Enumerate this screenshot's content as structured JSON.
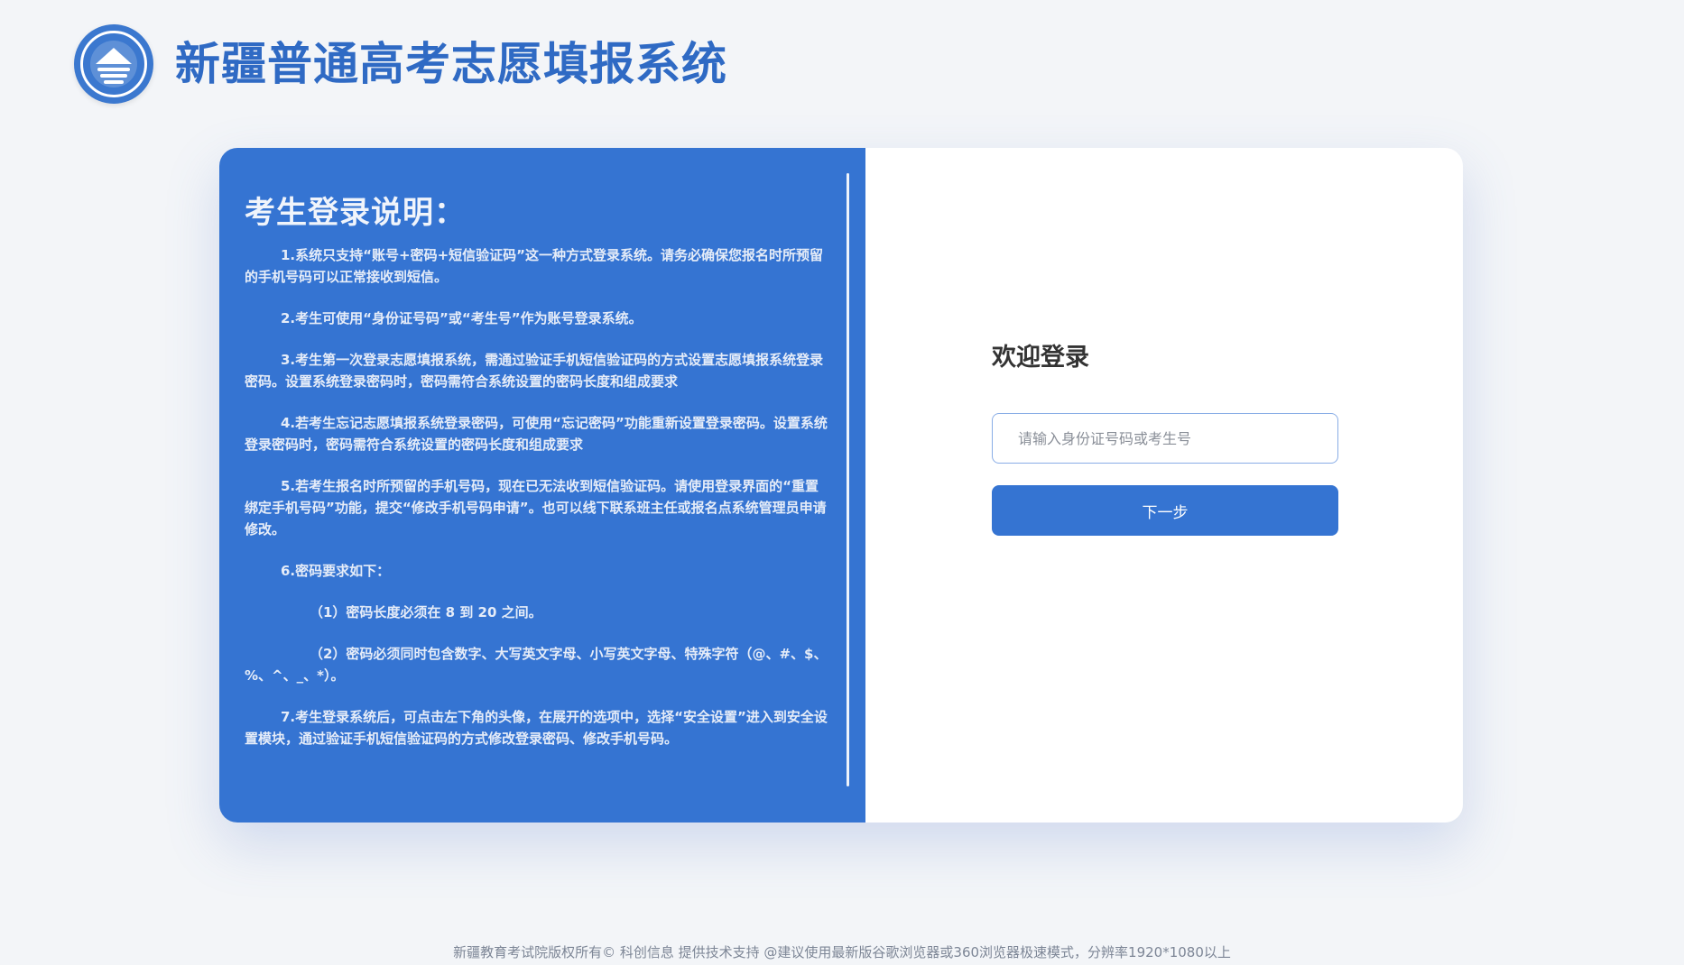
{
  "header": {
    "title": "新疆普通高考志愿填报系统",
    "logo_icon": "education-seal-icon"
  },
  "notice": {
    "title": "考生登录说明：",
    "items": [
      "1.系统只支持“账号+密码+短信验证码”这一种方式登录系统。请务必确保您报名时所预留的手机号码可以正常接收到短信。",
      "2.考生可使用“身份证号码”或“考生号”作为账号登录系统。",
      "3.考生第一次登录志愿填报系统，需通过验证手机短信验证码的方式设置志愿填报系统登录密码。设置系统登录密码时，密码需符合系统设置的密码长度和组成要求",
      "4.若考生忘记志愿填报系统登录密码，可使用“忘记密码”功能重新设置登录密码。设置系统登录密码时，密码需符合系统设置的密码长度和组成要求",
      "5.若考生报名时所预留的手机号码，现在已无法收到短信验证码。请使用登录界面的“重置绑定手机号码”功能，提交“修改手机号码申请”。也可以线下联系班主任或报名点系统管理员申请修改。",
      "6.密码要求如下：",
      "（1）密码长度必须在 8 到 20 之间。",
      "（2）密码必须同时包含数字、大写英文字母、小写英文字母、特殊字符（@、#、$、%、^、_、*）。",
      "7.考生登录系统后，可点击左下角的头像，在展开的选项中，选择“安全设置”进入到安全设置模块，通过验证手机短信验证码的方式修改登录密码、修改手机号码。"
    ]
  },
  "login": {
    "heading": "欢迎登录",
    "account_input": {
      "value": "",
      "placeholder": "请输入身份证号码或考生号"
    },
    "next_button_label": "下一步"
  },
  "footer": {
    "text": "新疆教育考试院版权所有© 科创信息 提供技术支持 @建议使用最新版谷歌浏览器或360浏览器极速模式，分辨率1920*1080以上"
  },
  "colors": {
    "brand_blue": "#3574d2",
    "title_blue": "#2f6ac4",
    "background": "#f3f5f8",
    "panel_white": "#ffffff",
    "input_border": "#89ade6"
  }
}
